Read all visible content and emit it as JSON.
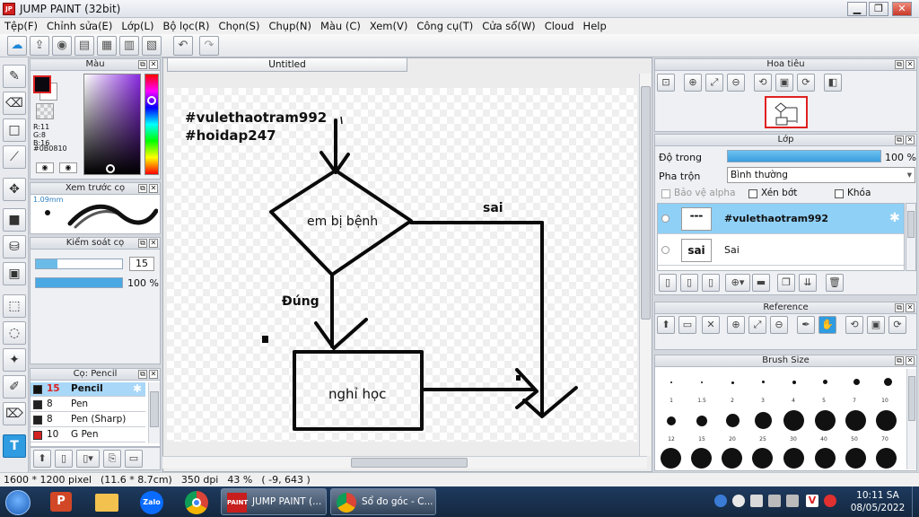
{
  "window": {
    "title": "JUMP PAINT (32bit)",
    "app_icon": "jump-paint-icon"
  },
  "menu": [
    "Tệp(F)",
    "Chỉnh sửa(E)",
    "Lớp(L)",
    "Bộ lọc(R)",
    "Chọn(S)",
    "Chụp(N)",
    "Màu (C)",
    "Xem(V)",
    "Công cụ(T)",
    "Cửa sổ(W)",
    "Cloud",
    "Help"
  ],
  "color_panel": {
    "title": "Màu",
    "r": "R:11",
    "g": "G:8",
    "b": "B:16",
    "hex": "#0B0810",
    "primary_color": "#0b0810"
  },
  "brush_preview": {
    "title": "Xem trước cọ",
    "size": "1.09mm"
  },
  "brush_control": {
    "title": "Kiểm soát cọ",
    "size_value": "15",
    "opacity_value": "100 %",
    "opacity_level": 1.0,
    "size_level": 0.25
  },
  "brush_list": {
    "title": "Cọ: Pencil",
    "items": [
      {
        "size": "15",
        "name": "Pencil",
        "color": "#111111",
        "selected": true
      },
      {
        "size": "8",
        "name": "Pen",
        "color": "#222222",
        "selected": false
      },
      {
        "size": "8",
        "name": "Pen (Sharp)",
        "color": "#222222",
        "selected": false
      },
      {
        "size": "10",
        "name": "G Pen",
        "color": "#d22222",
        "selected": false
      }
    ]
  },
  "document": {
    "tab": "Untitled"
  },
  "canvas_text": {
    "tag1": "#vulethaotram992",
    "tag2": "#hoidap247",
    "decision": "em bị bệnh",
    "no_label": "sai",
    "yes_label": "Đúng",
    "process": "nghỉ học"
  },
  "navigator": {
    "title": "Hoa tiêu"
  },
  "layer_panel": {
    "title": "Lớp",
    "opacity_label": "Độ trong",
    "opacity_value": "100 %",
    "opacity_level": 1.0,
    "blend_label": "Pha trộn",
    "blend_value": "Bình thường",
    "protect_alpha": "Bảo vệ alpha",
    "clip": "Xén bớt",
    "lock": "Khóa",
    "layers": [
      {
        "name": "#vulethaotram992",
        "selected": true
      },
      {
        "name": "Sai",
        "selected": false
      }
    ]
  },
  "reference": {
    "title": "Reference"
  },
  "brush_size": {
    "title": "Brush Size",
    "row1": [
      "1",
      "1.5",
      "2",
      "3",
      "4",
      "5",
      "7",
      "10"
    ],
    "row2": [
      "12",
      "15",
      "20",
      "25",
      "30",
      "40",
      "50",
      "70"
    ]
  },
  "status": {
    "pixels": "1600 * 1200 pixel",
    "size": "(11.6 * 8.7cm)",
    "dpi": "350 dpi",
    "zoom": "43 %",
    "coords": "( -9, 643 )"
  },
  "taskbar": {
    "windows": [
      {
        "label": "JUMP PAINT (...",
        "icon": "jump-paint-icon"
      },
      {
        "label": "Sổ đo góc - C...",
        "icon": "chrome-icon"
      }
    ],
    "time": "10:11 SA",
    "date": "08/05/2022"
  }
}
